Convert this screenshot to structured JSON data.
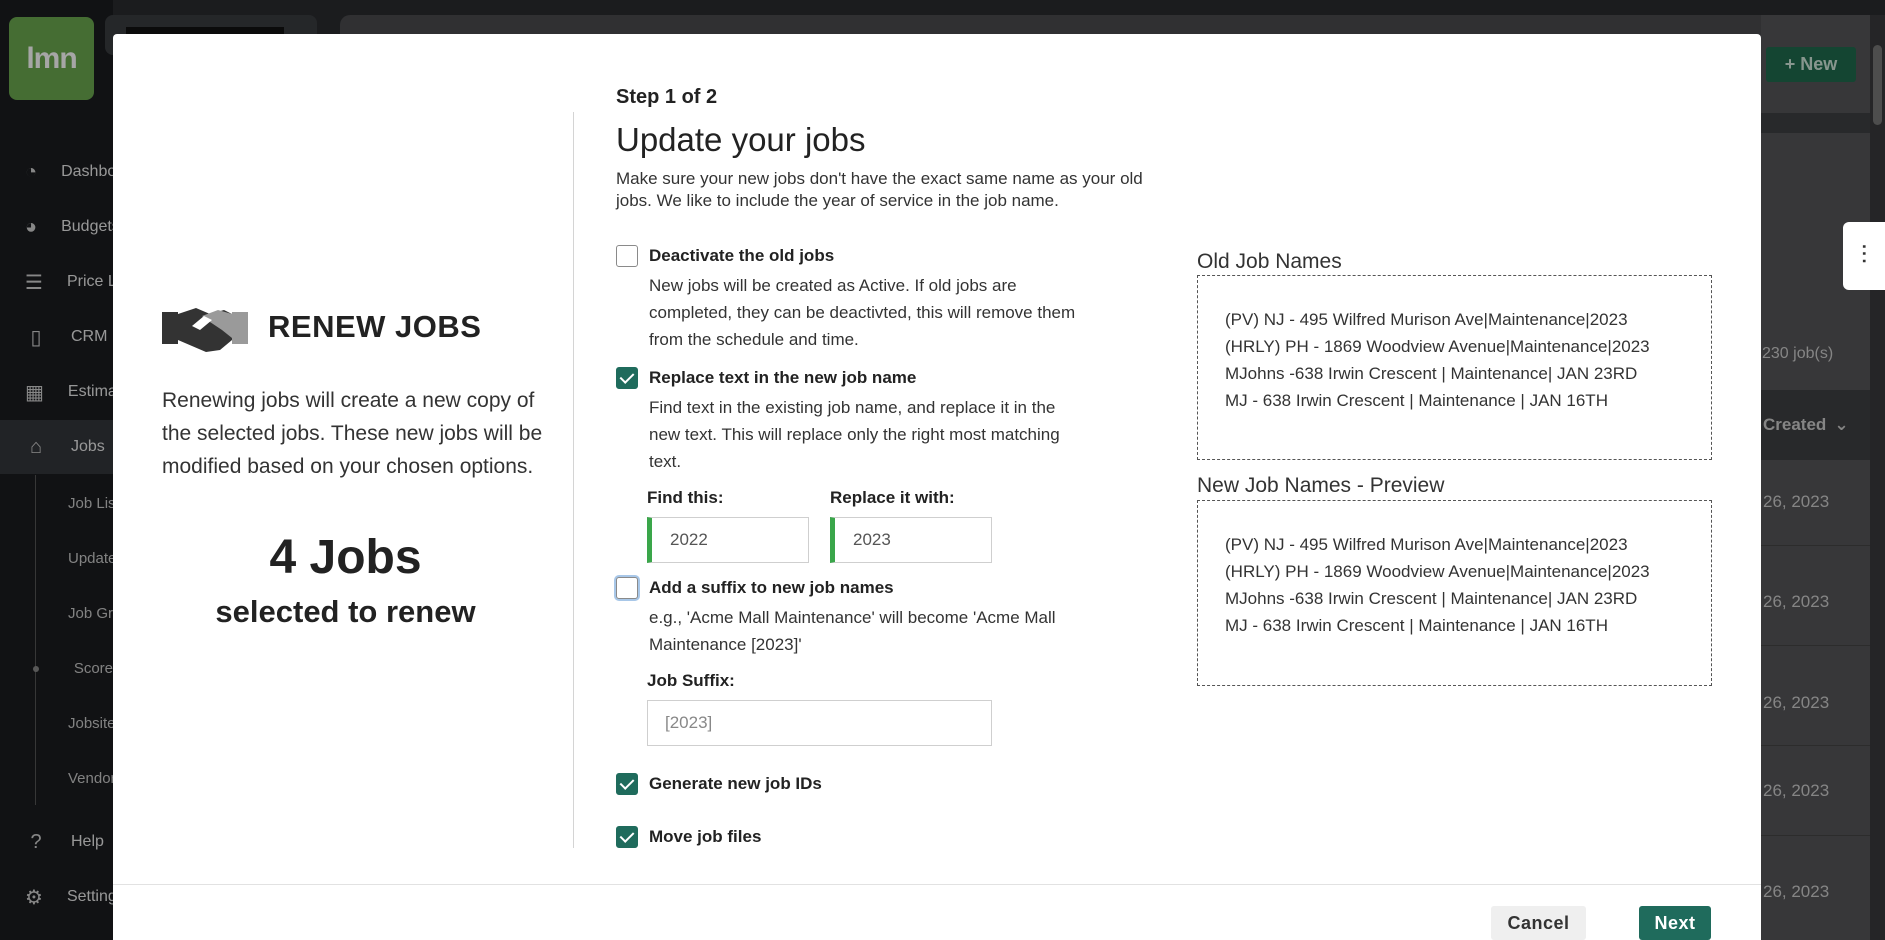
{
  "app": {
    "logo_text": "lmn",
    "nav": [
      {
        "label": "Dashboard",
        "icon": "dashboard-icon"
      },
      {
        "label": "Budgets",
        "icon": "pie-chart-icon"
      },
      {
        "label": "Price Lists",
        "icon": "list-icon"
      },
      {
        "label": "CRM",
        "icon": "contact-card-icon"
      },
      {
        "label": "Estimates",
        "icon": "calculator-icon"
      },
      {
        "label": "Jobs",
        "icon": "jobs-icon"
      }
    ],
    "sub_nav": [
      "Job List",
      "Update",
      "Job Groups",
      "Score",
      "Jobsite",
      "Vendors"
    ],
    "bottom_nav": [
      {
        "label": "Help",
        "icon": "help-icon"
      },
      {
        "label": "Settings",
        "icon": "gear-icon"
      }
    ],
    "new_button": "+ New",
    "job_count": "230 job(s)",
    "created_header": "Created",
    "row_dates": [
      "26, 2023",
      "26, 2023",
      "26, 2023",
      "26, 2023",
      "26, 2023"
    ]
  },
  "modal": {
    "hero_title": "RENEW JOBS",
    "hero_desc": "Renewing jobs will create a new copy of the selected jobs. These new jobs will be modified based on your chosen options.",
    "count": "4 Jobs",
    "count_sub": "selected to renew",
    "step": "Step 1 of 2",
    "title": "Update your jobs",
    "subtitle": "Make sure your new jobs don't have the exact same name as your old jobs. We like to include the year of service in the job name.",
    "options": {
      "deactivate": {
        "label": "Deactivate the old jobs",
        "desc": "New jobs will be created as Active. If old jobs are completed, they can be deactivted, this will remove them from the schedule and time.",
        "checked": false
      },
      "replace": {
        "label": "Replace text in the new job name",
        "desc": "Find text in the existing job name, and replace it in the new text. This will replace only the right most matching text.",
        "checked": true
      },
      "suffix": {
        "label": "Add a suffix to new job names",
        "desc": "e.g., 'Acme Mall Maintenance' will become 'Acme Mall Maintenance [2023]'",
        "checked": false
      },
      "new_ids": {
        "label": "Generate new job IDs",
        "checked": true
      },
      "move_files": {
        "label": "Move job files",
        "checked": true
      }
    },
    "find_label": "Find this:",
    "find_value": "2022",
    "replace_label": "Replace it with:",
    "replace_value": "2023",
    "suffix_label": "Job Suffix:",
    "suffix_placeholder": "[2023]",
    "old_names_title": "Old Job Names",
    "old_names": [
      "(PV) NJ - 495 Wilfred Murison Ave|Maintenance|2023",
      "(HRLY) PH - 1869 Woodview Avenue|Maintenance|2023",
      "MJohns -638 Irwin Crescent | Maintenance| JAN 23RD",
      "MJ - 638 Irwin Crescent | Maintenance | JAN 16TH"
    ],
    "new_names_title": "New Job Names - Preview",
    "new_names": [
      "(PV) NJ - 495 Wilfred Murison Ave|Maintenance|2023",
      "(HRLY) PH - 1869 Woodview Avenue|Maintenance|2023",
      "MJohns -638 Irwin Crescent | Maintenance| JAN 23RD",
      "MJ - 638 Irwin Crescent | Maintenance | JAN 16TH"
    ],
    "cancel": "Cancel",
    "next": "Next"
  }
}
